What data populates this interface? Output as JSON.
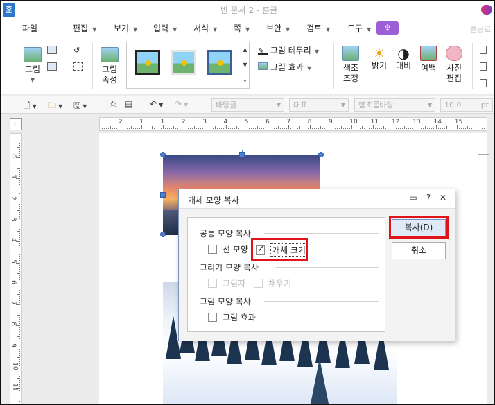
{
  "window": {
    "app_icon": "훈",
    "title": "빈 문서 2 - 훈글"
  },
  "menubar": {
    "items": [
      "파일",
      "편집",
      "보기",
      "입력",
      "서식",
      "쪽",
      "보안",
      "검토",
      "도구"
    ],
    "plugin_icon": "♆",
    "right_text": "훈글로"
  },
  "ribbon": {
    "picture_label": "그림",
    "picture_props_label": [
      "그림",
      "속성"
    ],
    "border_label": "그림 테두리",
    "effect_label": "그림 효과",
    "color_adjust_label": [
      "색조",
      "조정"
    ],
    "brightness_label": "밝기",
    "contrast_label": "대비",
    "margin_label": "여백",
    "photo_edit_label": [
      "사진",
      "편집"
    ]
  },
  "toolbar": {
    "style_value": "바탕글",
    "rep_value": "대표",
    "font_value": "함초롬바탕",
    "size_value": "10.0",
    "size_unit": "pt"
  },
  "ruler": {
    "h_numbers": [
      "2",
      "1",
      "1",
      "2",
      "3",
      "4",
      "5",
      "6",
      "7",
      "8",
      "9",
      "10",
      "11",
      "12",
      "13",
      "14",
      "15"
    ],
    "v_numbers": [
      "0",
      "1",
      "2",
      "3",
      "4",
      "5",
      "6",
      "7",
      "8",
      "9",
      "10",
      "11"
    ]
  },
  "dialog": {
    "title": "개체 모양 복사",
    "help_icon": "?",
    "close_icon": "✕",
    "sections": {
      "common": {
        "title": "공통 모양 복사",
        "line_shape": "선 모양",
        "object_size": "개체 크기"
      },
      "drawing": {
        "title": "그리기 모양 복사",
        "shadow": "그림자",
        "fill": "채우기"
      },
      "picture": {
        "title": "그림 모양 복사",
        "picture_effect": "그림 효과"
      }
    },
    "checked": {
      "line_shape": false,
      "object_size": true,
      "shadow": false,
      "fill": false,
      "picture_effect": false
    },
    "copy_button": "복사(D)",
    "cancel_button": "취소"
  },
  "colors": {
    "highlight": "#e0131b",
    "accent": "#4f7fcf",
    "plugin": "#9c5fd6"
  }
}
